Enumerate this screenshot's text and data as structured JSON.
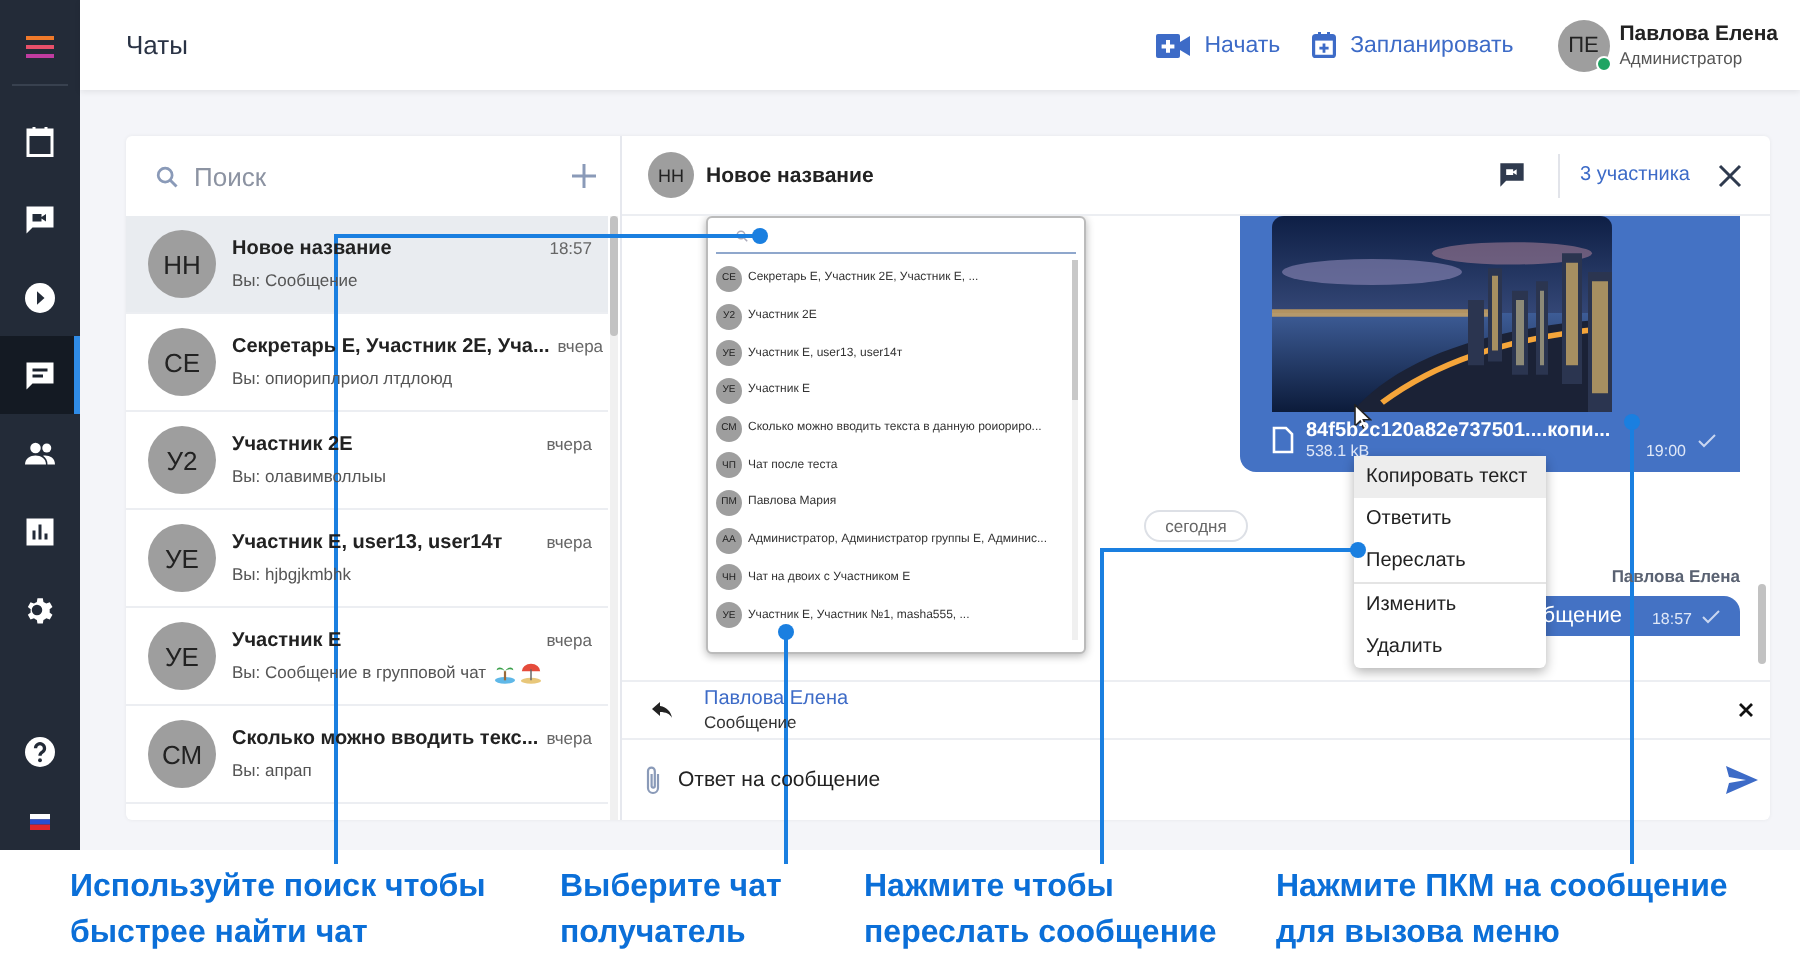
{
  "sidebar": {
    "nav": [
      {
        "selected": false
      },
      {
        "selected": false
      },
      {
        "selected": false
      },
      {
        "selected": true
      },
      {
        "selected": false
      },
      {
        "selected": false
      },
      {
        "selected": false
      }
    ]
  },
  "header": {
    "title": "Чаты",
    "actions": [
      "Начать",
      "Запланировать"
    ],
    "user": {
      "initials": "ПЕ",
      "name": "Павлова Елена",
      "role": "Администратор",
      "online": true
    }
  },
  "chat_list": {
    "search": {
      "placeholder": "Поиск"
    },
    "chats": [
      {
        "initials": "НН",
        "name": "Новое название",
        "time": "18:57",
        "preview": "Вы: Сообщение",
        "emoji": false,
        "selected": true
      },
      {
        "initials": "СЕ",
        "name": "Секретарь Е, Участник 2Е, Уча...",
        "time": "вчера",
        "preview": "Вы: опиориплриол лтдлоюд",
        "emoji": false,
        "selected": false
      },
      {
        "initials": "У2",
        "name": "Участник 2Е",
        "time": "вчера",
        "preview": "Вы: олавимволлыы",
        "emoji": false,
        "selected": false
      },
      {
        "initials": "УЕ",
        "name": "Участник Е, user13, user14т",
        "time": "вчера",
        "preview": "Вы: hjbgjkmbhk",
        "emoji": false,
        "selected": false
      },
      {
        "initials": "УЕ",
        "name": "Участник Е",
        "time": "вчера",
        "preview": "Вы: Сообщение в групповой чат",
        "emoji": true,
        "selected": false
      },
      {
        "initials": "СМ",
        "name": "Сколько можно вводить текс...",
        "time": "вчера",
        "preview": "Вы: апрап",
        "emoji": false,
        "selected": false
      }
    ]
  },
  "conversation": {
    "initials": "НН",
    "title": "Новое название",
    "participants": "3 участника",
    "image_message": {
      "file_name": "84f5b2c120a82e737501....копи...",
      "file_size": "538.1 kB",
      "time": "19:00",
      "read": true
    },
    "date_divider": "сегодня",
    "sender": "Павлова Елена",
    "text_message": {
      "text": "бщение",
      "time": "18:57",
      "read": true
    },
    "reply": {
      "name": "Павлова Елена",
      "text": "Сообщение"
    },
    "input": {
      "value": "Ответ на сообщение"
    }
  },
  "forward_popup": {
    "chats": [
      {
        "initials": "СЕ",
        "name": "Секретарь Е, Участник 2Е, Участник Е, ..."
      },
      {
        "initials": "У2",
        "name": "Участник 2Е"
      },
      {
        "initials": "УЕ",
        "name": "Участник Е, user13, user14т"
      },
      {
        "initials": "УЕ",
        "name": "Участник Е"
      },
      {
        "initials": "СМ",
        "name": "Сколько можно вводить текста в данную роиориро..."
      },
      {
        "initials": "ЧП",
        "name": "Чат после теста"
      },
      {
        "initials": "ПМ",
        "name": "Павлова Мария"
      },
      {
        "initials": "АА",
        "name": "Администратор, Администратор группы Е, Админис..."
      },
      {
        "initials": "ЧН",
        "name": "Чат на двоих с Участником Е"
      },
      {
        "initials": "УЕ",
        "name": "Участник Е, Участник №1, masha555, ..."
      }
    ]
  },
  "context_menu": {
    "items": [
      {
        "label": "Копировать текст",
        "selected": true,
        "separator_after": false
      },
      {
        "label": "Ответить",
        "selected": false,
        "separator_after": false
      },
      {
        "label": "Переслать",
        "selected": false,
        "separator_after": true
      },
      {
        "label": "Изменить",
        "selected": false,
        "separator_after": false
      },
      {
        "label": "Удалить",
        "selected": false,
        "separator_after": false
      }
    ]
  },
  "captions": [
    [
      "Используйте поиск чтобы",
      "быстрее найти чат"
    ],
    [
      "Выберите чат",
      "получатель"
    ],
    [
      "Нажмите чтобы",
      "переслать сообщение"
    ],
    [
      "Нажмите ПКМ на сообщение",
      "для вызова меню"
    ]
  ]
}
